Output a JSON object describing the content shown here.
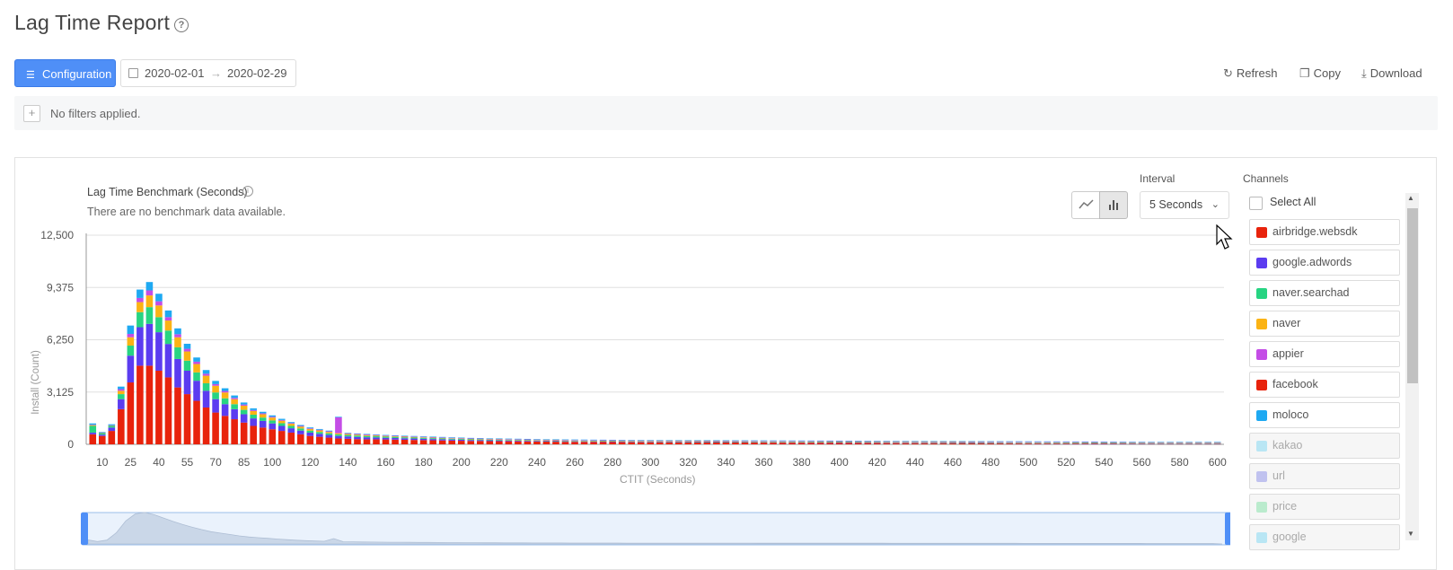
{
  "header": {
    "title": "Lag Time Report",
    "help_icon": "question-circle-icon"
  },
  "toolbar": {
    "config_label": "Configuration",
    "date_start": "2020-02-01",
    "date_end": "2020-02-29",
    "refresh_label": "Refresh",
    "copy_label": "Copy",
    "download_label": "Download"
  },
  "filters": {
    "text": "No filters applied."
  },
  "benchmark": {
    "title": "Lag Time Benchmark (Seconds)",
    "subtitle": "There are no benchmark data available."
  },
  "interval": {
    "label": "Interval",
    "value": "5 Seconds"
  },
  "channels": {
    "label": "Channels",
    "select_all": "Select All",
    "items": [
      {
        "label": "airbridge.websdk",
        "color": "#e8230c",
        "active": true
      },
      {
        "label": "google.adwords",
        "color": "#5b3cf0",
        "active": true
      },
      {
        "label": "naver.searchad",
        "color": "#27d482",
        "active": true
      },
      {
        "label": "naver",
        "color": "#fbb314",
        "active": true
      },
      {
        "label": "appier",
        "color": "#c44de6",
        "active": true
      },
      {
        "label": "facebook",
        "color": "#e8230c",
        "active": true
      },
      {
        "label": "moloco",
        "color": "#1ea9f2",
        "active": true
      },
      {
        "label": "kakao",
        "color": "#7cd6f2",
        "active": false
      },
      {
        "label": "url",
        "color": "#8a8de8",
        "active": false
      },
      {
        "label": "price",
        "color": "#7ee0a3",
        "active": false
      },
      {
        "label": "google",
        "color": "#7cd6f2",
        "active": false
      }
    ]
  },
  "chart_data": {
    "type": "bar",
    "stacked": true,
    "xlabel": "CTIT (Seconds)",
    "ylabel": "Install (Count)",
    "ylim": [
      0,
      12500
    ],
    "yticks": [
      "0",
      "3,125",
      "6,250",
      "9,375",
      "12,500"
    ],
    "xticks": [
      "10",
      "25",
      "40",
      "55",
      "70",
      "85",
      "100",
      "120",
      "140",
      "160",
      "180",
      "200",
      "220",
      "240",
      "260",
      "280",
      "300",
      "320",
      "340",
      "360",
      "380",
      "400",
      "420",
      "440",
      "460",
      "480",
      "500",
      "520",
      "540",
      "560",
      "580",
      "600"
    ],
    "bin_seconds": 5,
    "series": [
      {
        "name": "airbridge.websdk",
        "values": [
          600,
          500,
          800,
          2100,
          3700,
          4700,
          4700,
          4400,
          4000,
          3400,
          3000,
          2600,
          2200,
          1900,
          1700,
          1500,
          1300,
          1100,
          1000,
          900,
          800,
          700,
          600,
          500,
          450,
          400,
          350,
          330,
          310,
          300,
          300,
          290,
          280,
          270,
          260,
          250,
          240,
          230,
          220,
          210,
          200,
          200,
          190,
          185,
          180,
          175,
          170,
          165,
          160,
          155,
          150,
          148,
          145,
          142,
          140,
          138,
          135,
          132,
          130,
          128,
          126,
          124,
          122,
          120,
          118,
          116,
          114,
          112,
          110,
          108,
          106,
          104,
          102,
          100,
          98,
          96,
          94,
          92,
          90,
          88,
          86,
          84,
          82,
          80,
          78,
          76,
          74,
          72,
          70,
          68,
          66,
          64,
          62,
          60,
          58,
          56,
          54,
          52,
          50,
          48,
          46,
          44,
          42,
          40,
          38,
          36,
          34,
          32,
          30,
          28,
          26,
          24,
          22,
          20,
          20,
          20,
          20,
          20,
          20,
          20
        ]
      },
      {
        "name": "google.adwords",
        "values": [
          100,
          80,
          200,
          600,
          1600,
          2300,
          2500,
          2300,
          2000,
          1700,
          1400,
          1200,
          1000,
          800,
          700,
          600,
          500,
          450,
          400,
          350,
          300,
          260,
          220,
          200,
          180,
          160,
          150,
          140,
          130,
          120,
          110,
          100,
          95,
          90,
          85,
          80,
          75,
          70,
          65,
          60,
          55,
          50,
          48,
          46,
          44,
          42,
          40,
          38,
          36,
          34,
          32,
          30,
          28,
          26,
          24,
          22,
          20,
          20,
          20,
          20,
          20,
          20,
          20,
          20,
          20,
          20,
          20,
          20,
          20,
          20,
          20,
          20,
          20,
          20,
          20,
          20,
          20,
          20,
          20,
          20,
          20,
          20,
          20,
          20,
          20,
          20,
          20,
          20,
          20,
          20,
          20,
          20,
          20,
          20,
          20,
          20,
          20,
          20,
          20,
          20,
          20,
          20,
          20,
          20,
          20,
          20,
          20,
          20,
          20,
          20,
          20,
          20,
          20,
          20,
          20,
          20,
          20,
          20,
          20,
          20
        ]
      },
      {
        "name": "naver.searchad",
        "values": [
          400,
          100,
          100,
          300,
          600,
          900,
          1000,
          900,
          800,
          700,
          600,
          500,
          450,
          400,
          350,
          300,
          260,
          220,
          200,
          180,
          160,
          140,
          130,
          120,
          110,
          100,
          95,
          90,
          85,
          80,
          75,
          70,
          65,
          60,
          58,
          56,
          54,
          52,
          50,
          48,
          46,
          44,
          42,
          40,
          38,
          36,
          34,
          32,
          30,
          30,
          30,
          30,
          30,
          30,
          30,
          30,
          30,
          30,
          30,
          30,
          30,
          30,
          30,
          30,
          30,
          30,
          30,
          30,
          30,
          30,
          30,
          30,
          30,
          30,
          30,
          30,
          30,
          30,
          30,
          30,
          30,
          30,
          30,
          30,
          30,
          30,
          30,
          30,
          30,
          30,
          30,
          30,
          30,
          30,
          30,
          30,
          30,
          30,
          30,
          30,
          30,
          30,
          30,
          30,
          30,
          30,
          30,
          30,
          30,
          30,
          30,
          30,
          30,
          30,
          30,
          30,
          30,
          30,
          30,
          30
        ]
      },
      {
        "name": "naver",
        "values": [
          50,
          20,
          30,
          200,
          500,
          600,
          700,
          700,
          600,
          600,
          550,
          500,
          450,
          400,
          350,
          300,
          250,
          220,
          200,
          170,
          150,
          130,
          110,
          100,
          90,
          80,
          70,
          60,
          55,
          50,
          45,
          40,
          38,
          36,
          34,
          32,
          30,
          28,
          26,
          24,
          22,
          20,
          20,
          20,
          20,
          20,
          20,
          20,
          20,
          20,
          20,
          20,
          20,
          20,
          20,
          20,
          20,
          20,
          20,
          20,
          20,
          20,
          20,
          20,
          20,
          20,
          20,
          20,
          20,
          20,
          20,
          20,
          20,
          20,
          20,
          20,
          20,
          20,
          20,
          20,
          20,
          20,
          20,
          20,
          20,
          20,
          20,
          20,
          20,
          20,
          20,
          20,
          20,
          20,
          20,
          20,
          20,
          20,
          20,
          20,
          20,
          20,
          20,
          20,
          20,
          20,
          20,
          20,
          20,
          20,
          20,
          20,
          20,
          20,
          20,
          20,
          20,
          20,
          20,
          20
        ]
      },
      {
        "name": "appier",
        "values": [
          20,
          10,
          10,
          100,
          200,
          250,
          300,
          250,
          200,
          180,
          160,
          140,
          120,
          100,
          90,
          80,
          70,
          60,
          55,
          50,
          45,
          40,
          40,
          40,
          40,
          40,
          950,
          40,
          40,
          40,
          30,
          30,
          30,
          30,
          30,
          30,
          30,
          30,
          30,
          30,
          30,
          30,
          30,
          30,
          30,
          30,
          30,
          30,
          30,
          30,
          30,
          30,
          30,
          30,
          30,
          30,
          30,
          30,
          30,
          30,
          30,
          30,
          30,
          30,
          30,
          30,
          30,
          30,
          30,
          30,
          30,
          30,
          30,
          30,
          30,
          30,
          30,
          30,
          30,
          30,
          30,
          30,
          30,
          30,
          30,
          30,
          30,
          30,
          30,
          30,
          30,
          30,
          30,
          30,
          30,
          30,
          30,
          30,
          30,
          30,
          30,
          30,
          30,
          30,
          30,
          30,
          30,
          30,
          30,
          30,
          30,
          30,
          30,
          30,
          30,
          30,
          30,
          30,
          30,
          30
        ]
      },
      {
        "name": "moloco",
        "values": [
          80,
          30,
          60,
          150,
          500,
          500,
          500,
          450,
          400,
          350,
          300,
          250,
          220,
          190,
          160,
          140,
          120,
          100,
          90,
          80,
          70,
          60,
          55,
          50,
          45,
          40,
          35,
          30,
          30,
          30,
          30,
          30,
          30,
          30,
          30,
          30,
          30,
          30,
          30,
          30,
          30,
          30,
          30,
          30,
          30,
          30,
          30,
          30,
          30,
          30,
          30,
          30,
          30,
          30,
          30,
          30,
          30,
          30,
          30,
          30,
          30,
          30,
          30,
          30,
          30,
          30,
          30,
          30,
          30,
          30,
          30,
          30,
          30,
          30,
          30,
          30,
          30,
          30,
          30,
          30,
          30,
          30,
          30,
          30,
          30,
          30,
          30,
          30,
          30,
          30,
          30,
          30,
          30,
          30,
          30,
          30,
          30,
          30,
          30,
          30,
          30,
          30,
          30,
          30,
          30,
          30,
          30,
          30,
          30,
          30,
          30,
          30,
          30,
          30,
          30,
          30,
          30,
          30,
          30,
          30
        ]
      }
    ],
    "series_colors": [
      "#e8230c",
      "#5b3cf0",
      "#27d482",
      "#fbb314",
      "#c44de6",
      "#1ea9f2"
    ],
    "grid": true,
    "legend": "right"
  }
}
